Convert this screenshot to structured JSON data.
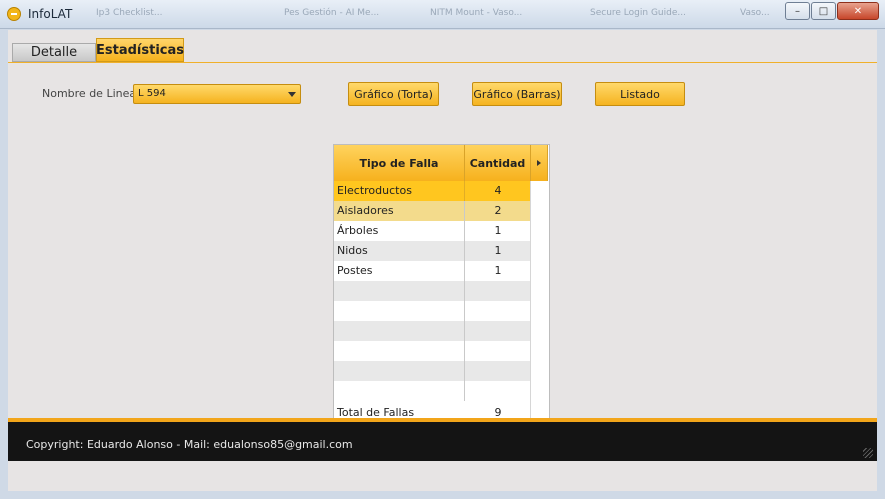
{
  "window": {
    "title": "InfoLAT"
  },
  "taskbar_hints": [
    "Ip3 Checklist...",
    "Pes Gestión - AI Me...",
    "NITM Mount - Vaso...",
    "Secure Login Guide...",
    "Vaso..."
  ],
  "caption_buttons": {
    "minimize": "minimize-icon",
    "maximize": "maximize-icon",
    "close": "close-icon"
  },
  "tabs": [
    {
      "label": "Detalle",
      "active": false
    },
    {
      "label": "Estadísticas",
      "active": true
    }
  ],
  "form": {
    "line_label": "Nombre de Linea:",
    "line_value": "L 594",
    "buttons": {
      "pie": "Gráfico (Torta)",
      "bars": "Gráfico (Barras)",
      "list": "Listado"
    }
  },
  "grid": {
    "columns": [
      "Tipo de Falla",
      "Cantidad"
    ],
    "rows": [
      {
        "tipo": "Electroductos",
        "cantidad": "4"
      },
      {
        "tipo": "Aisladores",
        "cantidad": "2"
      },
      {
        "tipo": "Árboles",
        "cantidad": "1"
      },
      {
        "tipo": "Nidos",
        "cantidad": "1"
      },
      {
        "tipo": "Postes",
        "cantidad": "1"
      }
    ],
    "footer": {
      "label": "Total de Fallas",
      "value": "9"
    }
  },
  "footer": {
    "copyright": "Copyright: Eduardo Alonso - Mail: edualonso85@gmail.com"
  },
  "colors": {
    "accent": "#f5b320",
    "selected_row": "#ffc61f",
    "alt_row": "#f3db8c",
    "footer_bg": "#141414"
  }
}
